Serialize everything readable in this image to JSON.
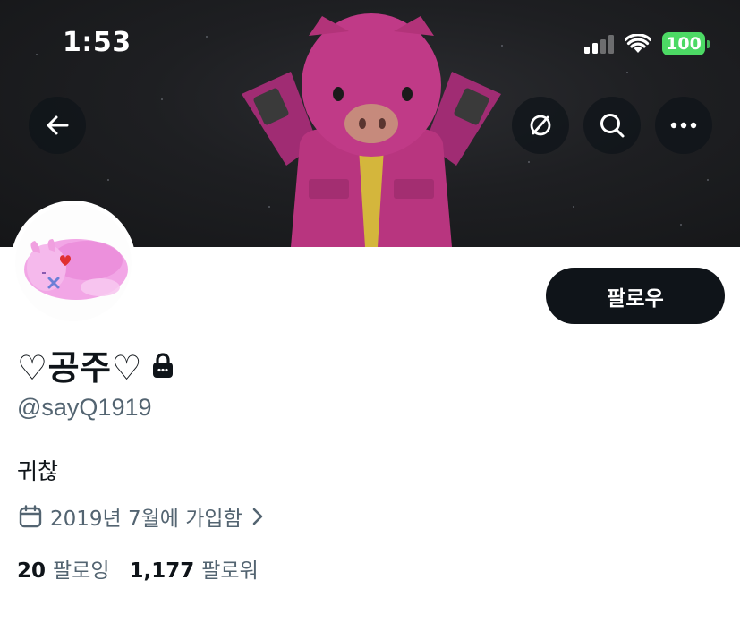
{
  "status_bar": {
    "time": "1:53",
    "battery": "100",
    "signal_icon": "cellular-signal-icon",
    "wifi_icon": "wifi-icon"
  },
  "header": {
    "back_icon": "back-arrow-icon",
    "actions": [
      "hide-icon",
      "search-icon",
      "more-icon"
    ]
  },
  "profile": {
    "display_name": "♡공주♡",
    "handle": "@sayQ1919",
    "bio": "귀찮",
    "joined": "2019년 7월에 가입함",
    "following_count": "20",
    "following_label": "팔로잉",
    "followers_count": "1,177",
    "followers_label": "팔로워",
    "protected_icon": "lock-icon"
  },
  "actions": {
    "follow_label": "팔로우"
  },
  "colors": {
    "primary_text": "#0f1419",
    "secondary_text": "#536471",
    "battery_green": "#4cd964",
    "banner_bg": "#1e1f22"
  }
}
